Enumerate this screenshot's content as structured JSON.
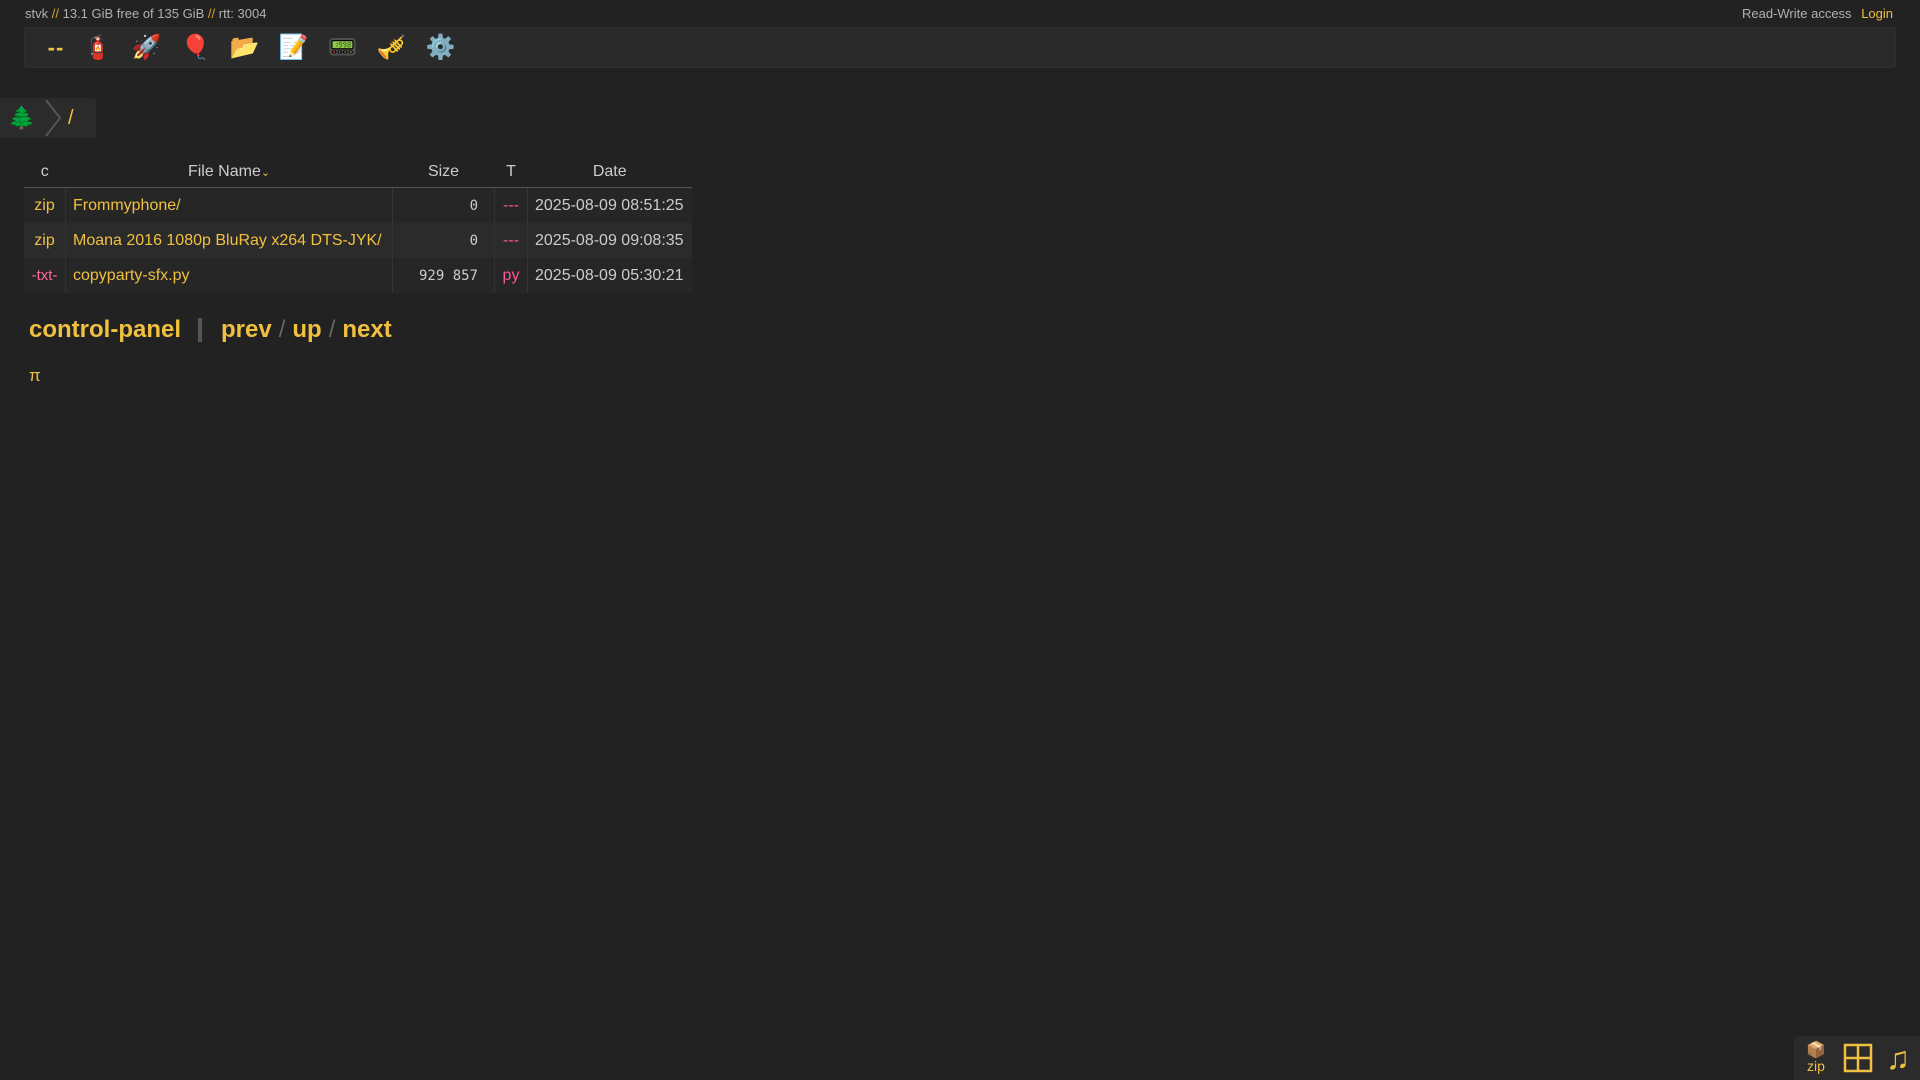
{
  "status": {
    "host": "stvk",
    "sep1": "//",
    "disk": "13.1 GiB free of 135 GiB",
    "sep2": "//",
    "rtt": "rtt: 3004"
  },
  "auth": {
    "access": "Read-Write access",
    "login": "Login"
  },
  "toolbar": {
    "buttons": [
      {
        "name": "dash",
        "glyph": "--"
      },
      {
        "name": "extinguisher-icon",
        "glyph": "🧯"
      },
      {
        "name": "rocket-icon",
        "glyph": "🚀"
      },
      {
        "name": "balloon-icon",
        "glyph": "🎈"
      },
      {
        "name": "folder-icon",
        "glyph": "📂"
      },
      {
        "name": "memo-icon",
        "glyph": "📝"
      },
      {
        "name": "pager-icon",
        "glyph": "📟"
      },
      {
        "name": "trumpet-icon",
        "glyph": "🎺"
      },
      {
        "name": "gear-icon",
        "glyph": "⚙️"
      }
    ]
  },
  "breadcrumb": {
    "tree_icon": "🌲",
    "root": "/"
  },
  "table": {
    "headers": {
      "c": "c",
      "name": "File Name",
      "sort_arrow": "⌄",
      "size": "Size",
      "type": "T",
      "date": "Date"
    },
    "rows": [
      {
        "c": "zip",
        "name": "Frommyphone/",
        "size": "0",
        "type": "---",
        "date": "2025-08-09 08:51:25"
      },
      {
        "c": "zip",
        "name": "Moana 2016 1080p BluRay x264 DTS-JYK/",
        "size": "0",
        "type": "---",
        "date": "2025-08-09 09:08:35"
      },
      {
        "c": "-txt-",
        "name": "copyparty-sfx.py",
        "size": "929 857",
        "type": "py",
        "date": "2025-08-09 05:30:21"
      }
    ]
  },
  "nav": {
    "control_panel": "control-panel",
    "prev": "prev",
    "up": "up",
    "next": "next",
    "slash": "/"
  },
  "pi": "π",
  "widget": {
    "zip_icon": "📦",
    "zip_label": "zip",
    "music": "♫"
  },
  "colors": {
    "accent": "#f0c040",
    "background": "#222222",
    "pink": "#ff5599"
  }
}
